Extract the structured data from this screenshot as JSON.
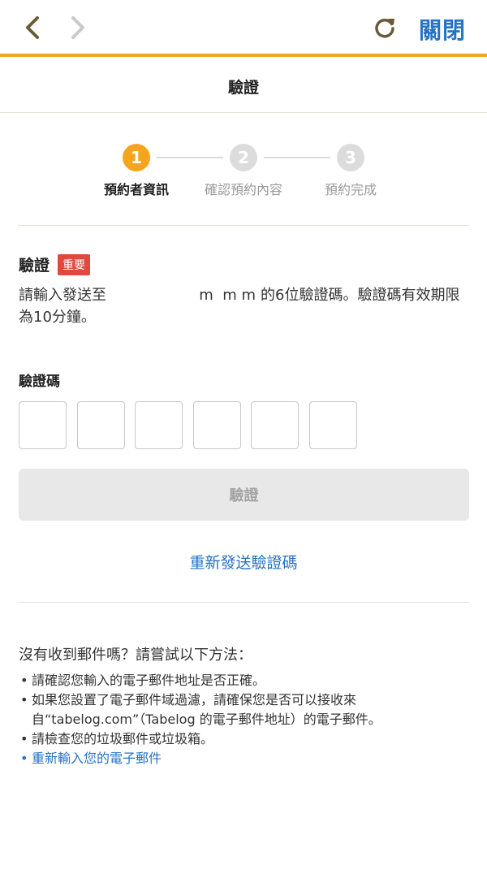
{
  "header": {
    "close_label": "關閉",
    "accent_color": "#f2a621",
    "icons": [
      "chevron-left-icon",
      "chevron-right-icon",
      "reload-icon"
    ]
  },
  "title": "驗證",
  "steps": [
    {
      "number": "1",
      "label": "預約者資訊",
      "state": "active"
    },
    {
      "number": "2",
      "label": "確認預約內容",
      "state": "inactive"
    },
    {
      "number": "3",
      "label": "預約完成",
      "state": "inactive"
    }
  ],
  "verification": {
    "heading": "驗證",
    "badge": "重要",
    "instruction_prefix": "請輸入發送至",
    "masked_email": "m  m m",
    "instruction_suffix": "的6位驗證碼。驗證碼有效期限為10分鐘。"
  },
  "code": {
    "label": "驗證碼",
    "digits": 6
  },
  "verify_button": "驗證",
  "resend_link": "重新發送驗證碼",
  "help": {
    "title": "沒有收到郵件嗎？請嘗試以下方法：",
    "items": [
      "請確認您輸入的電子郵件地址是否正確。",
      "如果您設置了電子郵件域過濾，請確保您是否可以接收來自“tabelog.com”（Tabelog 的電子郵件地址）的電子郵件。",
      "請檢查您的垃圾郵件或垃圾箱。"
    ],
    "link": "重新輸入您的電子郵件"
  },
  "colors": {
    "active_step": "#f5a51d",
    "inactive_step": "#dcdcdc",
    "link": "#2673c4",
    "badge": "#e04a3c"
  }
}
